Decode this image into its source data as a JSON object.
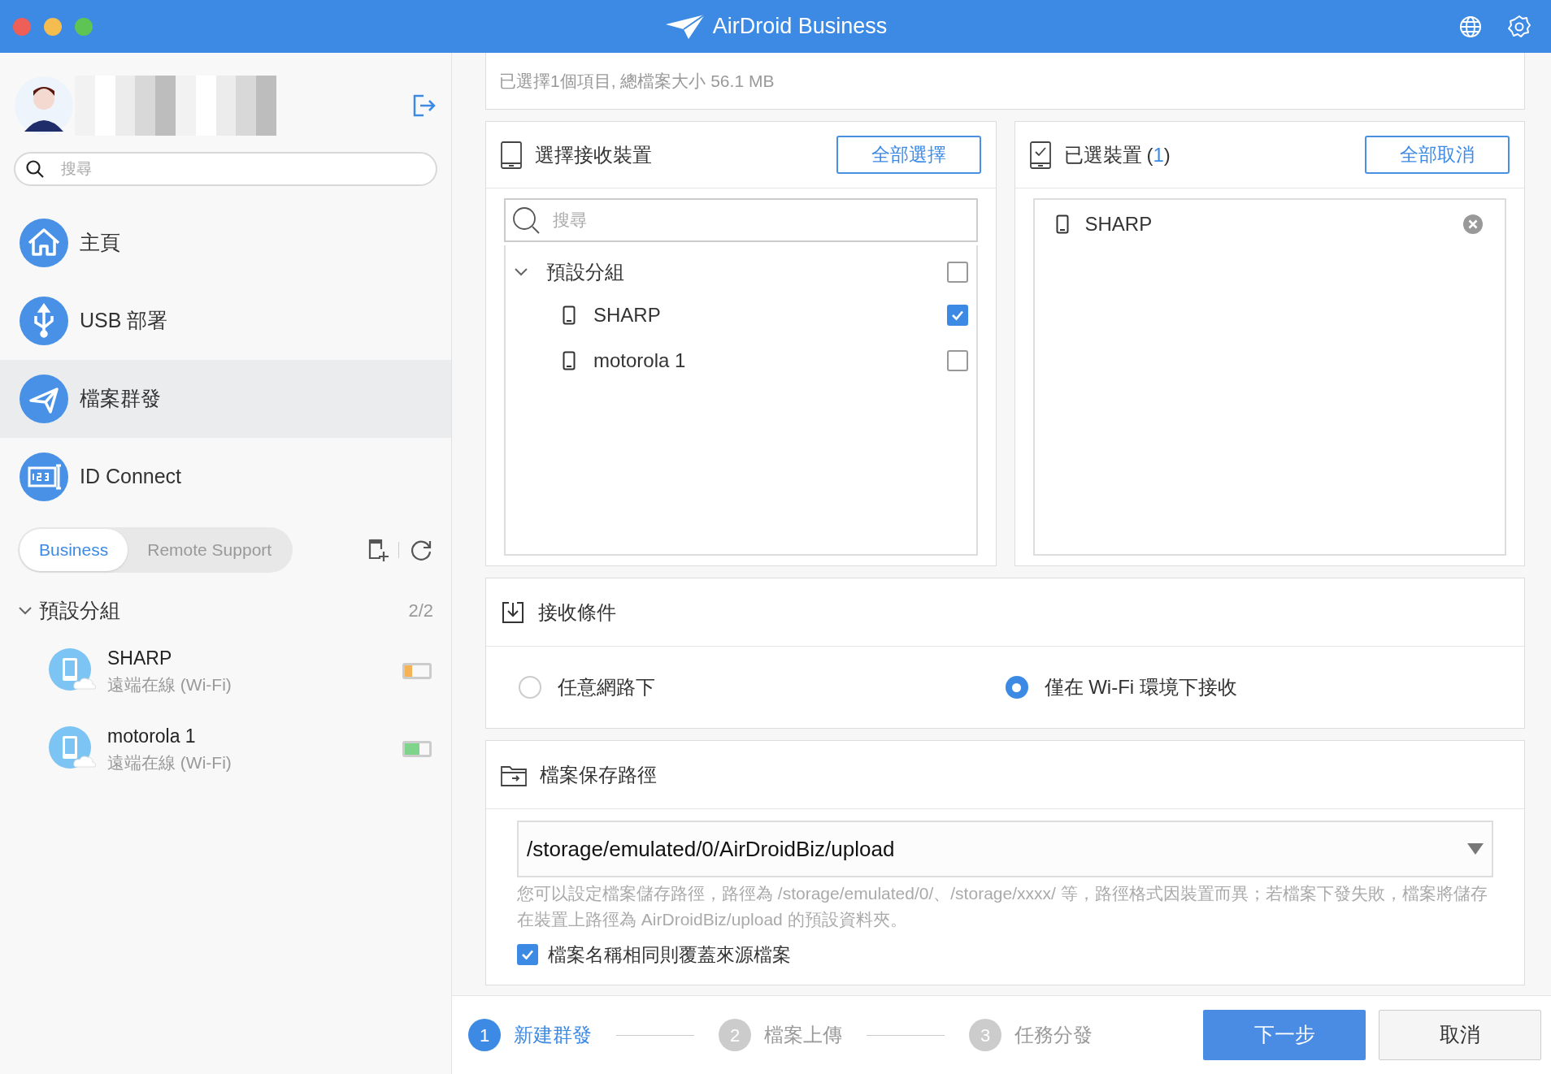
{
  "window": {
    "title": "AirDroid Business"
  },
  "sidebar": {
    "search": {
      "placeholder": "搜尋"
    },
    "nav": [
      {
        "label": "主頁",
        "selected": false
      },
      {
        "label": "USB 部署",
        "selected": false
      },
      {
        "label": "檔案群發",
        "selected": true
      },
      {
        "label": "ID Connect",
        "selected": false
      }
    ],
    "tabs": [
      {
        "label": "Business",
        "selected": true
      },
      {
        "label": "Remote Support",
        "selected": false
      }
    ],
    "group": {
      "name": "預設分組",
      "count": "2/2",
      "expanded": true,
      "devices": [
        {
          "name": "SHARP",
          "status": "遠端在線 (Wi-Fi)",
          "battery": {
            "level": 0.3,
            "color": "#f5b356"
          }
        },
        {
          "name": "motorola 1",
          "status": "遠端在線 (Wi-Fi)",
          "battery": {
            "level": 0.6,
            "color": "#7fd48b"
          }
        }
      ]
    }
  },
  "summary": "已選擇1個項目, 總檔案大小 56.1 MB",
  "device_picker": {
    "title": "選擇接收裝置",
    "button": "全部選擇",
    "search": {
      "placeholder": "搜尋"
    },
    "group": {
      "name": "預設分組",
      "expanded": true,
      "checked": false,
      "devices": [
        {
          "name": "SHARP",
          "checked": true
        },
        {
          "name": "motorola 1",
          "checked": false
        }
      ]
    }
  },
  "selected_devices": {
    "title": "已選裝置",
    "count": {
      "open": "(",
      "value": "1",
      "close": ")"
    },
    "button": "全部取消",
    "devices": [
      {
        "name": "SHARP"
      }
    ]
  },
  "receive_condition": {
    "title": "接收條件",
    "options": [
      {
        "label": "任意網路下",
        "selected": false
      },
      {
        "label": "僅在 Wi-Fi 環境下接收",
        "selected": true
      }
    ]
  },
  "save_path": {
    "title": "檔案保存路徑",
    "value": "/storage/emulated/0/AirDroidBiz/upload",
    "hint": "您可以設定檔案儲存路徑，路徑為 /storage/emulated/0/、/storage/xxxx/ 等，路徑格式因裝置而異；若檔案下發失敗，檔案將儲存在裝置上路徑為 AirDroidBiz/upload 的預設資料夾。",
    "overwrite": {
      "label": "檔案名稱相同則覆蓋來源檔案",
      "checked": true
    }
  },
  "steps": [
    {
      "number": "1",
      "label": "新建群發",
      "selected": true
    },
    {
      "number": "2",
      "label": "檔案上傳",
      "selected": false
    },
    {
      "number": "3",
      "label": "任務分發",
      "selected": false
    }
  ],
  "buttons": {
    "next": "下一步",
    "cancel": "取消"
  }
}
